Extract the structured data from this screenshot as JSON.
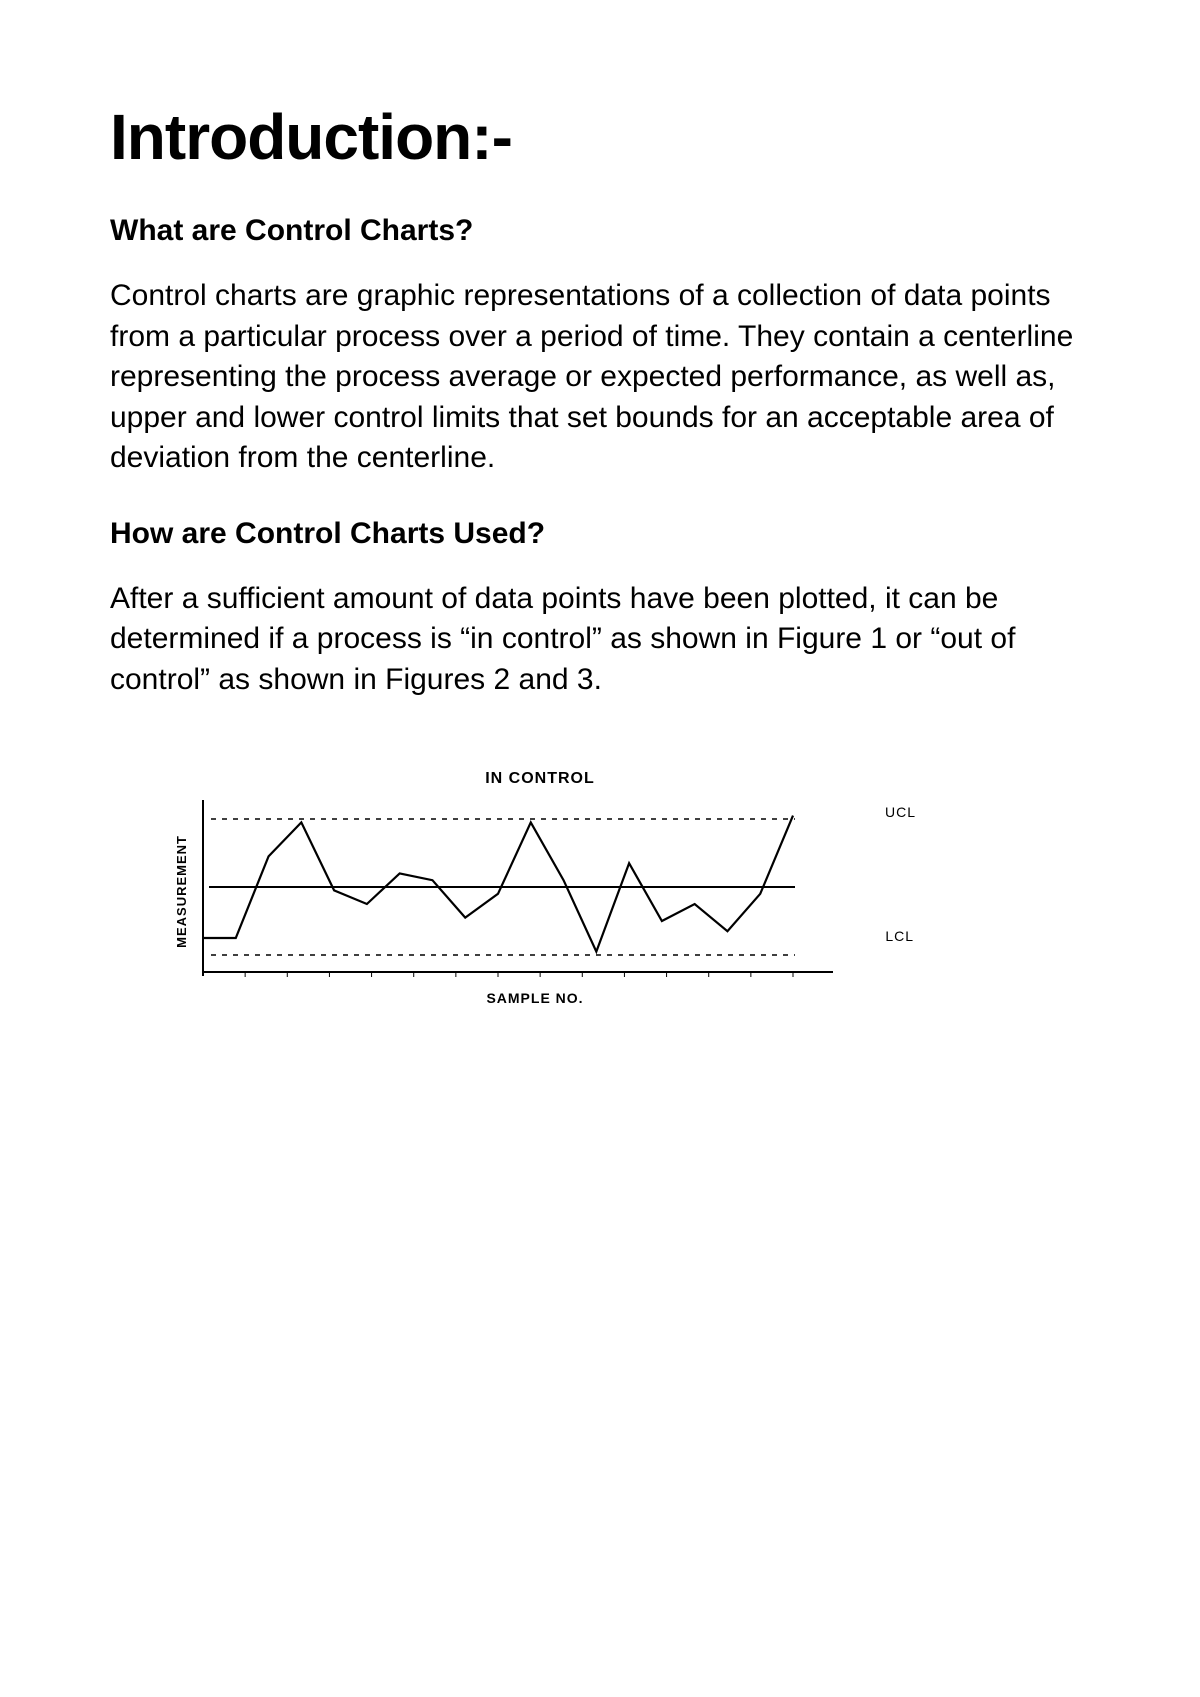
{
  "title": "Introduction:-",
  "section1": {
    "heading": "What are Control Charts?",
    "body": "Control charts are graphic representations of a collection of data points from a particular process over a period of time. They contain a centerline representing the process average or expected performance, as well as, upper and lower control limits that set bounds for an acceptable area of deviation from the centerline."
  },
  "section2": {
    "heading": "How are Control Charts Used?",
    "body": "After a sufficient amount of data points have been plotted, it can be determined if a process is “in control” as shown in Figure 1 or “out of control” as shown in Figures 2 and 3."
  },
  "chart_data": {
    "type": "line",
    "title": "IN CONTROL",
    "xlabel": "SAMPLE NO.",
    "ylabel": "MEASUREMENT",
    "ucl_label": "UCL",
    "lcl_label": "LCL",
    "centerline": 50,
    "ucl": 90,
    "lcl": 10,
    "ylim": [
      0,
      100
    ],
    "x": [
      1,
      2,
      3,
      4,
      5,
      6,
      7,
      8,
      9,
      10,
      11,
      12,
      13,
      14,
      15
    ],
    "values": [
      20,
      20,
      68,
      88,
      48,
      40,
      58,
      54,
      32,
      46,
      88,
      54,
      12,
      64,
      30,
      40,
      24,
      46,
      92
    ]
  }
}
